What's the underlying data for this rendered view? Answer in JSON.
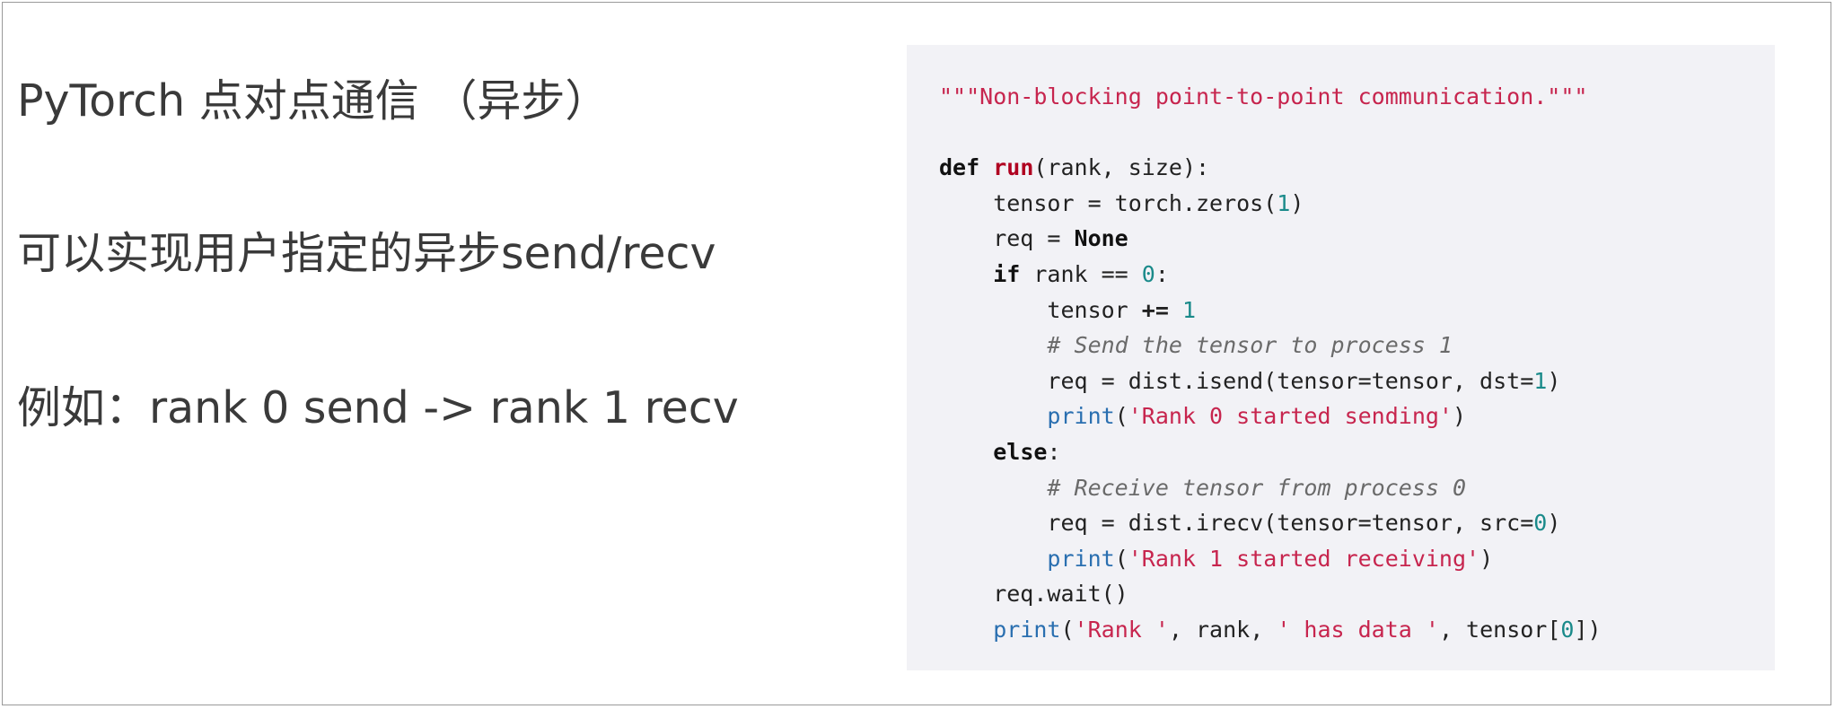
{
  "slide": {
    "title": "PyTorch 点对点通信 （异步）",
    "description": "可以实现用户指定的异步send/recv",
    "example": "例如：rank 0 send -> rank 1 recv"
  },
  "code_lines": [
    [
      {
        "t": "\"\"\"Non-blocking point-to-point communication.\"\"\"",
        "c": "str"
      }
    ],
    [],
    [
      {
        "t": "def",
        "c": "kw"
      },
      {
        "t": " "
      },
      {
        "t": "run",
        "c": "fn"
      },
      {
        "t": "(rank, size):"
      }
    ],
    [
      {
        "t": "    tensor = torch.zeros("
      },
      {
        "t": "1",
        "c": "num"
      },
      {
        "t": ")"
      }
    ],
    [
      {
        "t": "    req = "
      },
      {
        "t": "None",
        "c": "kw"
      }
    ],
    [
      {
        "t": "    "
      },
      {
        "t": "if",
        "c": "kw"
      },
      {
        "t": " rank == "
      },
      {
        "t": "0",
        "c": "num"
      },
      {
        "t": ":"
      }
    ],
    [
      {
        "t": "        tensor "
      },
      {
        "t": "+=",
        "c": "op"
      },
      {
        "t": " "
      },
      {
        "t": "1",
        "c": "num"
      }
    ],
    [
      {
        "t": "        "
      },
      {
        "t": "# Send the tensor to process 1",
        "c": "cm"
      }
    ],
    [
      {
        "t": "        req = dist.isend(tensor=tensor, dst="
      },
      {
        "t": "1",
        "c": "num"
      },
      {
        "t": ")"
      }
    ],
    [
      {
        "t": "        "
      },
      {
        "t": "print",
        "c": "bi"
      },
      {
        "t": "("
      },
      {
        "t": "'Rank 0 started sending'",
        "c": "str"
      },
      {
        "t": ")"
      }
    ],
    [
      {
        "t": "    "
      },
      {
        "t": "else",
        "c": "kw"
      },
      {
        "t": ":"
      }
    ],
    [
      {
        "t": "        "
      },
      {
        "t": "# Receive tensor from process 0",
        "c": "cm"
      }
    ],
    [
      {
        "t": "        req = dist.irecv(tensor=tensor, src="
      },
      {
        "t": "0",
        "c": "num"
      },
      {
        "t": ")"
      }
    ],
    [
      {
        "t": "        "
      },
      {
        "t": "print",
        "c": "bi"
      },
      {
        "t": "("
      },
      {
        "t": "'Rank 1 started receiving'",
        "c": "str"
      },
      {
        "t": ")"
      }
    ],
    [
      {
        "t": "    req.wait()"
      }
    ],
    [
      {
        "t": "    "
      },
      {
        "t": "print",
        "c": "bi"
      },
      {
        "t": "("
      },
      {
        "t": "'Rank '",
        "c": "str"
      },
      {
        "t": ", rank, "
      },
      {
        "t": "' has data '",
        "c": "str"
      },
      {
        "t": ", tensor["
      },
      {
        "t": "0",
        "c": "num"
      },
      {
        "t": "])"
      }
    ]
  ],
  "colors": {
    "string": "#c7254e",
    "keyword": "#111111",
    "function_name": "#b00020",
    "number": "#1a8a8a",
    "comment": "#6a6a6a",
    "builtin": "#2a6fb0",
    "code_background": "#f2f2f6",
    "heading_text": "#3a3a3a"
  }
}
